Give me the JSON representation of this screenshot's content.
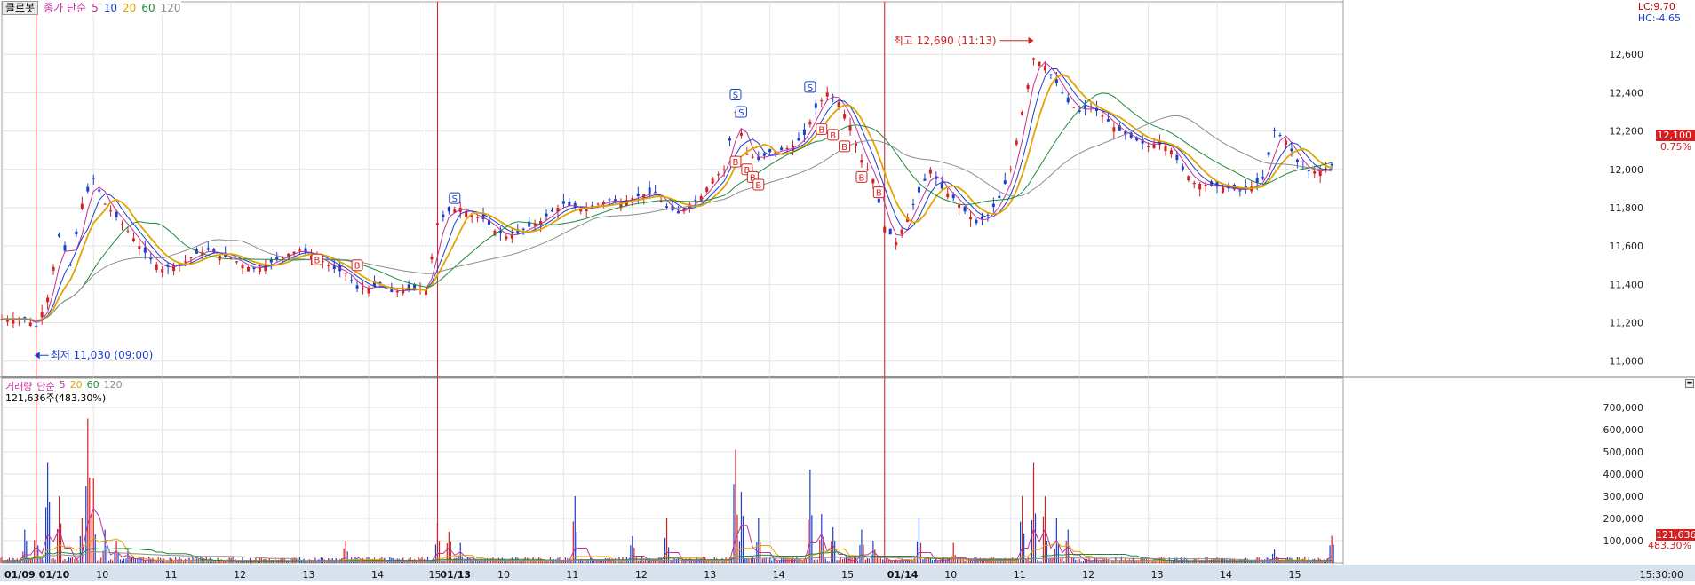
{
  "toolbar": {
    "item_name": "클로봇",
    "price_ma_label": "종가 단순",
    "ma_periods": [
      "5",
      "10",
      "20",
      "60",
      "120"
    ],
    "ma_colors": [
      "#c0309a",
      "#1a3ecf",
      "#e1a400",
      "#1e8a3a",
      "#8c8c8c"
    ]
  },
  "limits": {
    "upper": "LC:9.70",
    "lower": "HC:-4.65"
  },
  "current_price": {
    "value": "12,100",
    "change_pct": "0.75%"
  },
  "annotations": {
    "high": "최고 12,690 (11:13)",
    "low": "최저 11,030 (09:00)"
  },
  "volume_panel": {
    "title": "거래량",
    "ma_label": "단순",
    "ma_periods": [
      "5",
      "20",
      "60",
      "120"
    ],
    "ma_colors": [
      "#c0309a",
      "#e1a400",
      "#1e8a3a",
      "#8c8c8c"
    ],
    "summary": "121,636주(483.30%)",
    "current_value": "121,636",
    "current_pct": "483.30%"
  },
  "time_axis": {
    "labels": [
      "01/09",
      "01/10",
      "10",
      "11",
      "12",
      "13",
      "14",
      "15",
      "01/13",
      "10",
      "11",
      "12",
      "13",
      "14",
      "15",
      "01/14",
      "10",
      "11",
      "12",
      "13",
      "14",
      "15"
    ],
    "end_time": "15:30:00"
  },
  "chart_data": [
    {
      "type": "candlestick",
      "title": "클로봇",
      "ylim": [
        10920,
        12800
      ],
      "y_ticks": [
        11000,
        11200,
        11400,
        11600,
        11800,
        12000,
        12200,
        12400,
        12600
      ],
      "y_tick_labels": [
        "11,000",
        "11,200",
        "11,400",
        "11,600",
        "11,800",
        "12,000",
        "12,200",
        "12,400",
        "12,600"
      ],
      "grid": true,
      "series_close": [
        [
          0,
          11220
        ],
        [
          4,
          11220
        ],
        [
          6,
          11180
        ],
        [
          8,
          11330
        ],
        [
          10,
          11650
        ],
        [
          12,
          11500
        ],
        [
          14,
          11820
        ],
        [
          16,
          11950
        ],
        [
          18,
          11820
        ],
        [
          20,
          11750
        ],
        [
          22,
          11680
        ],
        [
          24,
          11600
        ],
        [
          26,
          11530
        ],
        [
          28,
          11480
        ],
        [
          30,
          11500
        ],
        [
          32,
          11520
        ],
        [
          34,
          11560
        ],
        [
          36,
          11580
        ],
        [
          38,
          11550
        ],
        [
          40,
          11540
        ],
        [
          42,
          11500
        ],
        [
          44,
          11480
        ],
        [
          46,
          11500
        ],
        [
          48,
          11530
        ],
        [
          50,
          11560
        ],
        [
          52,
          11580
        ],
        [
          54,
          11550
        ],
        [
          56,
          11520
        ],
        [
          58,
          11480
        ],
        [
          60,
          11460
        ],
        [
          62,
          11380
        ],
        [
          64,
          11380
        ],
        [
          66,
          11400
        ],
        [
          68,
          11360
        ],
        [
          70,
          11370
        ],
        [
          72,
          11380
        ],
        [
          74,
          11370
        ],
        [
          76,
          11720
        ],
        [
          78,
          11780
        ],
        [
          80,
          11800
        ],
        [
          82,
          11760
        ],
        [
          84,
          11740
        ],
        [
          86,
          11680
        ],
        [
          88,
          11650
        ],
        [
          90,
          11670
        ],
        [
          92,
          11700
        ],
        [
          94,
          11730
        ],
        [
          96,
          11780
        ],
        [
          98,
          11820
        ],
        [
          100,
          11800
        ],
        [
          102,
          11790
        ],
        [
          104,
          11820
        ],
        [
          106,
          11840
        ],
        [
          108,
          11830
        ],
        [
          110,
          11850
        ],
        [
          112,
          11870
        ],
        [
          114,
          11880
        ],
        [
          116,
          11800
        ],
        [
          118,
          11770
        ],
        [
          120,
          11820
        ],
        [
          122,
          11860
        ],
        [
          124,
          11950
        ],
        [
          126,
          12000
        ],
        [
          128,
          12300
        ],
        [
          130,
          12080
        ],
        [
          132,
          12050
        ],
        [
          134,
          12090
        ],
        [
          136,
          12100
        ],
        [
          138,
          12120
        ],
        [
          140,
          12180
        ],
        [
          142,
          12320
        ],
        [
          144,
          12400
        ],
        [
          146,
          12350
        ],
        [
          148,
          12230
        ],
        [
          150,
          12050
        ],
        [
          152,
          11950
        ],
        [
          154,
          11700
        ],
        [
          156,
          11620
        ],
        [
          158,
          11750
        ],
        [
          160,
          11880
        ],
        [
          162,
          12000
        ],
        [
          164,
          11900
        ],
        [
          166,
          11850
        ],
        [
          168,
          11780
        ],
        [
          170,
          11720
        ],
        [
          172,
          11760
        ],
        [
          174,
          11850
        ],
        [
          176,
          12000
        ],
        [
          178,
          12300
        ],
        [
          180,
          12580
        ],
        [
          182,
          12540
        ],
        [
          184,
          12450
        ],
        [
          186,
          12350
        ],
        [
          188,
          12300
        ],
        [
          190,
          12330
        ],
        [
          192,
          12280
        ],
        [
          194,
          12220
        ],
        [
          196,
          12180
        ],
        [
          198,
          12150
        ],
        [
          200,
          12120
        ],
        [
          202,
          12150
        ],
        [
          204,
          12100
        ],
        [
          206,
          12000
        ],
        [
          208,
          11930
        ],
        [
          210,
          11920
        ],
        [
          212,
          11910
        ],
        [
          214,
          11900
        ],
        [
          216,
          11890
        ],
        [
          218,
          11910
        ],
        [
          220,
          11950
        ],
        [
          222,
          12200
        ],
        [
          224,
          12150
        ],
        [
          226,
          12040
        ],
        [
          228,
          11990
        ],
        [
          230,
          11990
        ],
        [
          232,
          12020
        ]
      ],
      "ma_series": [
        {
          "name": "5",
          "color": "#c0309a"
        },
        {
          "name": "10",
          "color": "#1a3ecf"
        },
        {
          "name": "20",
          "color": "#e1a400"
        },
        {
          "name": "60",
          "color": "#1e8a3a"
        },
        {
          "name": "120",
          "color": "#8c8c8c"
        }
      ],
      "high_label_x": 180,
      "low_label_x": 6,
      "signals": [
        {
          "x": 55,
          "y": 11530,
          "t": "B"
        },
        {
          "x": 62,
          "y": 11500,
          "t": "B"
        },
        {
          "x": 79,
          "y": 11850,
          "t": "S"
        },
        {
          "x": 128,
          "y": 12390,
          "t": "S"
        },
        {
          "x": 129,
          "y": 12300,
          "t": "S"
        },
        {
          "x": 128,
          "y": 12040,
          "t": "B"
        },
        {
          "x": 130,
          "y": 12000,
          "t": "B"
        },
        {
          "x": 131,
          "y": 11960,
          "t": "B"
        },
        {
          "x": 132,
          "y": 11920,
          "t": "B"
        },
        {
          "x": 141,
          "y": 12430,
          "t": "S"
        },
        {
          "x": 143,
          "y": 12210,
          "t": "B"
        },
        {
          "x": 145,
          "y": 12180,
          "t": "B"
        },
        {
          "x": 147,
          "y": 12120,
          "t": "B"
        },
        {
          "x": 150,
          "y": 11960,
          "t": "B"
        },
        {
          "x": 153,
          "y": 11880,
          "t": "B"
        }
      ]
    },
    {
      "type": "bar",
      "title": "거래량",
      "ylim": [
        0,
        800000
      ],
      "y_ticks": [
        100000,
        200000,
        300000,
        400000,
        500000,
        600000,
        700000
      ],
      "y_tick_labels": [
        "100,000",
        "200,000",
        "300,000",
        "400,000",
        "500,000",
        "600,000",
        "700,000"
      ],
      "spikes": [
        [
          4,
          150000
        ],
        [
          6,
          180000
        ],
        [
          8,
          450000
        ],
        [
          10,
          300000
        ],
        [
          14,
          200000
        ],
        [
          15,
          650000
        ],
        [
          16,
          380000
        ],
        [
          18,
          150000
        ],
        [
          20,
          100000
        ],
        [
          22,
          60000
        ],
        [
          60,
          100000
        ],
        [
          76,
          180000
        ],
        [
          78,
          140000
        ],
        [
          80,
          90000
        ],
        [
          100,
          300000
        ],
        [
          110,
          120000
        ],
        [
          116,
          200000
        ],
        [
          128,
          510000
        ],
        [
          129,
          320000
        ],
        [
          132,
          200000
        ],
        [
          141,
          420000
        ],
        [
          143,
          220000
        ],
        [
          145,
          160000
        ],
        [
          150,
          150000
        ],
        [
          152,
          100000
        ],
        [
          160,
          200000
        ],
        [
          166,
          90000
        ],
        [
          178,
          300000
        ],
        [
          180,
          450000
        ],
        [
          182,
          300000
        ],
        [
          184,
          200000
        ],
        [
          186,
          150000
        ],
        [
          222,
          60000
        ],
        [
          232,
          121636
        ]
      ],
      "base_volume": 15000
    }
  ]
}
